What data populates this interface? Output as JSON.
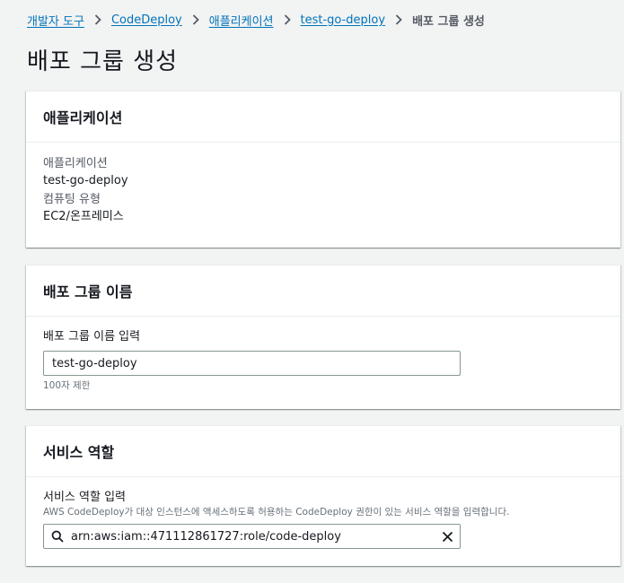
{
  "breadcrumb": {
    "items": [
      "개발자 도구",
      "CodeDeploy",
      "애플리케이션",
      "test-go-deploy"
    ],
    "current": "배포 그룹 생성"
  },
  "page_title": "배포 그룹 생성",
  "application_panel": {
    "title": "애플리케이션",
    "app_key": "애플리케이션",
    "app_value": "test-go-deploy",
    "platform_key": "컴퓨팅 유형",
    "platform_value": "EC2/온프레미스"
  },
  "group_name_panel": {
    "title": "배포 그룹 이름",
    "label": "배포 그룹 이름 입력",
    "value": "test-go-deploy",
    "constraint": "100자 제한"
  },
  "service_role_panel": {
    "title": "서비스 역할",
    "label": "서비스 역할 입력",
    "description": "AWS CodeDeploy가 대상 인스턴스에 액세스하도록 허용하는 CodeDeploy 권한이 있는 서비스 역할을 입력합니다.",
    "value": "arn:aws:iam::471112861727:role/code-deploy"
  },
  "colors": {
    "link": "#0073bb",
    "background": "#f2f3f3",
    "text": "#16191f",
    "secondary_text": "#545b64"
  },
  "icons": [
    "chevron-right-icon",
    "search-icon",
    "clear-icon"
  ]
}
